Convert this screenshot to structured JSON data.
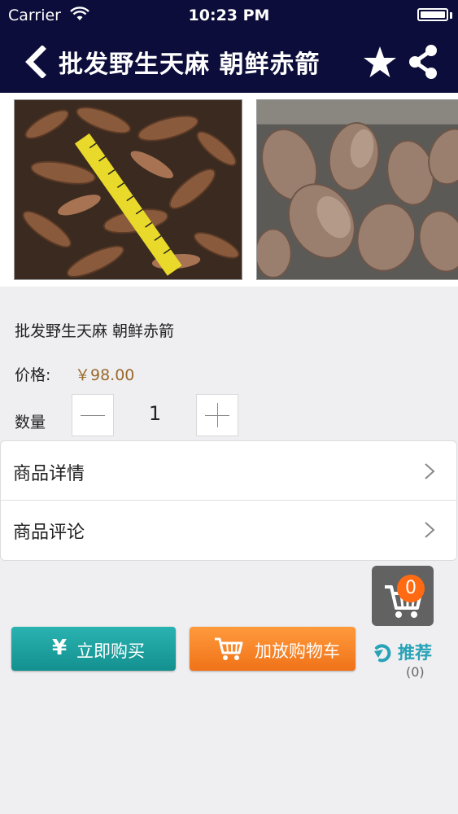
{
  "status_bar": {
    "carrier": "Carrier",
    "time": "10:23 PM"
  },
  "nav": {
    "title": "批发野生天麻 朝鲜赤箭",
    "back_icon": "chevron-left-icon",
    "favorite_icon": "star-icon",
    "share_icon": "share-icon"
  },
  "product": {
    "name": "批发野生天麻 朝鲜赤箭",
    "price_label": "价格:",
    "price_value": "￥98.00",
    "quantity_label": "数量",
    "quantity_value": "1"
  },
  "menu": {
    "items": [
      {
        "label": "商品详情"
      },
      {
        "label": "商品评论"
      }
    ]
  },
  "cart_float": {
    "count": "0"
  },
  "actions": {
    "buy_label": "立即购买",
    "buy_icon_text": "¥",
    "add_cart_label": "加放购物车"
  },
  "recommend": {
    "label": "推荐",
    "count": "(0)"
  },
  "colors": {
    "nav_bg": "#0c0d3a",
    "price": "#9a6a2c",
    "buy_button": "#1ba3a2",
    "cart_button": "#f6852a",
    "badge": "#ff6a12",
    "recommend": "#27a2b7"
  }
}
